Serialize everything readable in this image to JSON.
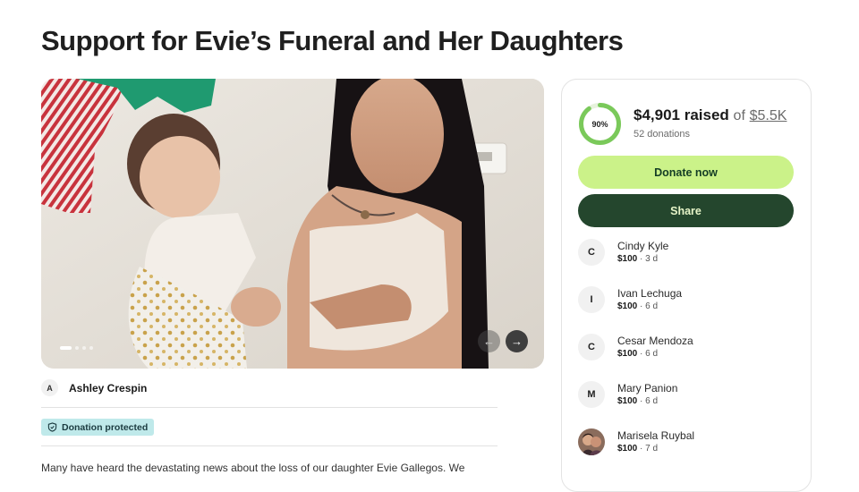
{
  "campaign": {
    "title": "Support for Evie’s Funeral and Her Daughters",
    "organizer": {
      "initial": "A",
      "name": "Ashley Crespin"
    },
    "badge": "Donation protected",
    "story_excerpt": "Many have heard the devastating news about the loss of our daughter Evie Gallegos. We",
    "gallery": {
      "slide_count": 4,
      "active_slide": 1,
      "prev_icon": "arrow-left-icon",
      "next_icon": "arrow-right-icon"
    }
  },
  "fundraiser": {
    "progress_percent": 90,
    "progress_label": "90%",
    "raised": "$4,901 raised",
    "of_text": "of",
    "goal": "$5.5K",
    "donation_count": "52 donations",
    "donate_label": "Donate now",
    "share_label": "Share",
    "colors": {
      "accent": "#cbf289",
      "dark": "#24462d",
      "progress": "#7ac95a",
      "badge": "#bfe9ea"
    }
  },
  "donors": [
    {
      "initial": "C",
      "name": "Cindy Kyle",
      "amount": "$100",
      "time": "3 d"
    },
    {
      "initial": "I",
      "name": "Ivan Lechuga",
      "amount": "$100",
      "time": "6 d"
    },
    {
      "initial": "C",
      "name": "Cesar Mendoza",
      "amount": "$100",
      "time": "6 d"
    },
    {
      "initial": "M",
      "name": "Mary Panion",
      "amount": "$100",
      "time": "6 d"
    },
    {
      "initial": "",
      "name": "Marisela Ruybal",
      "amount": "$100",
      "time": "7 d",
      "photo": true
    }
  ]
}
